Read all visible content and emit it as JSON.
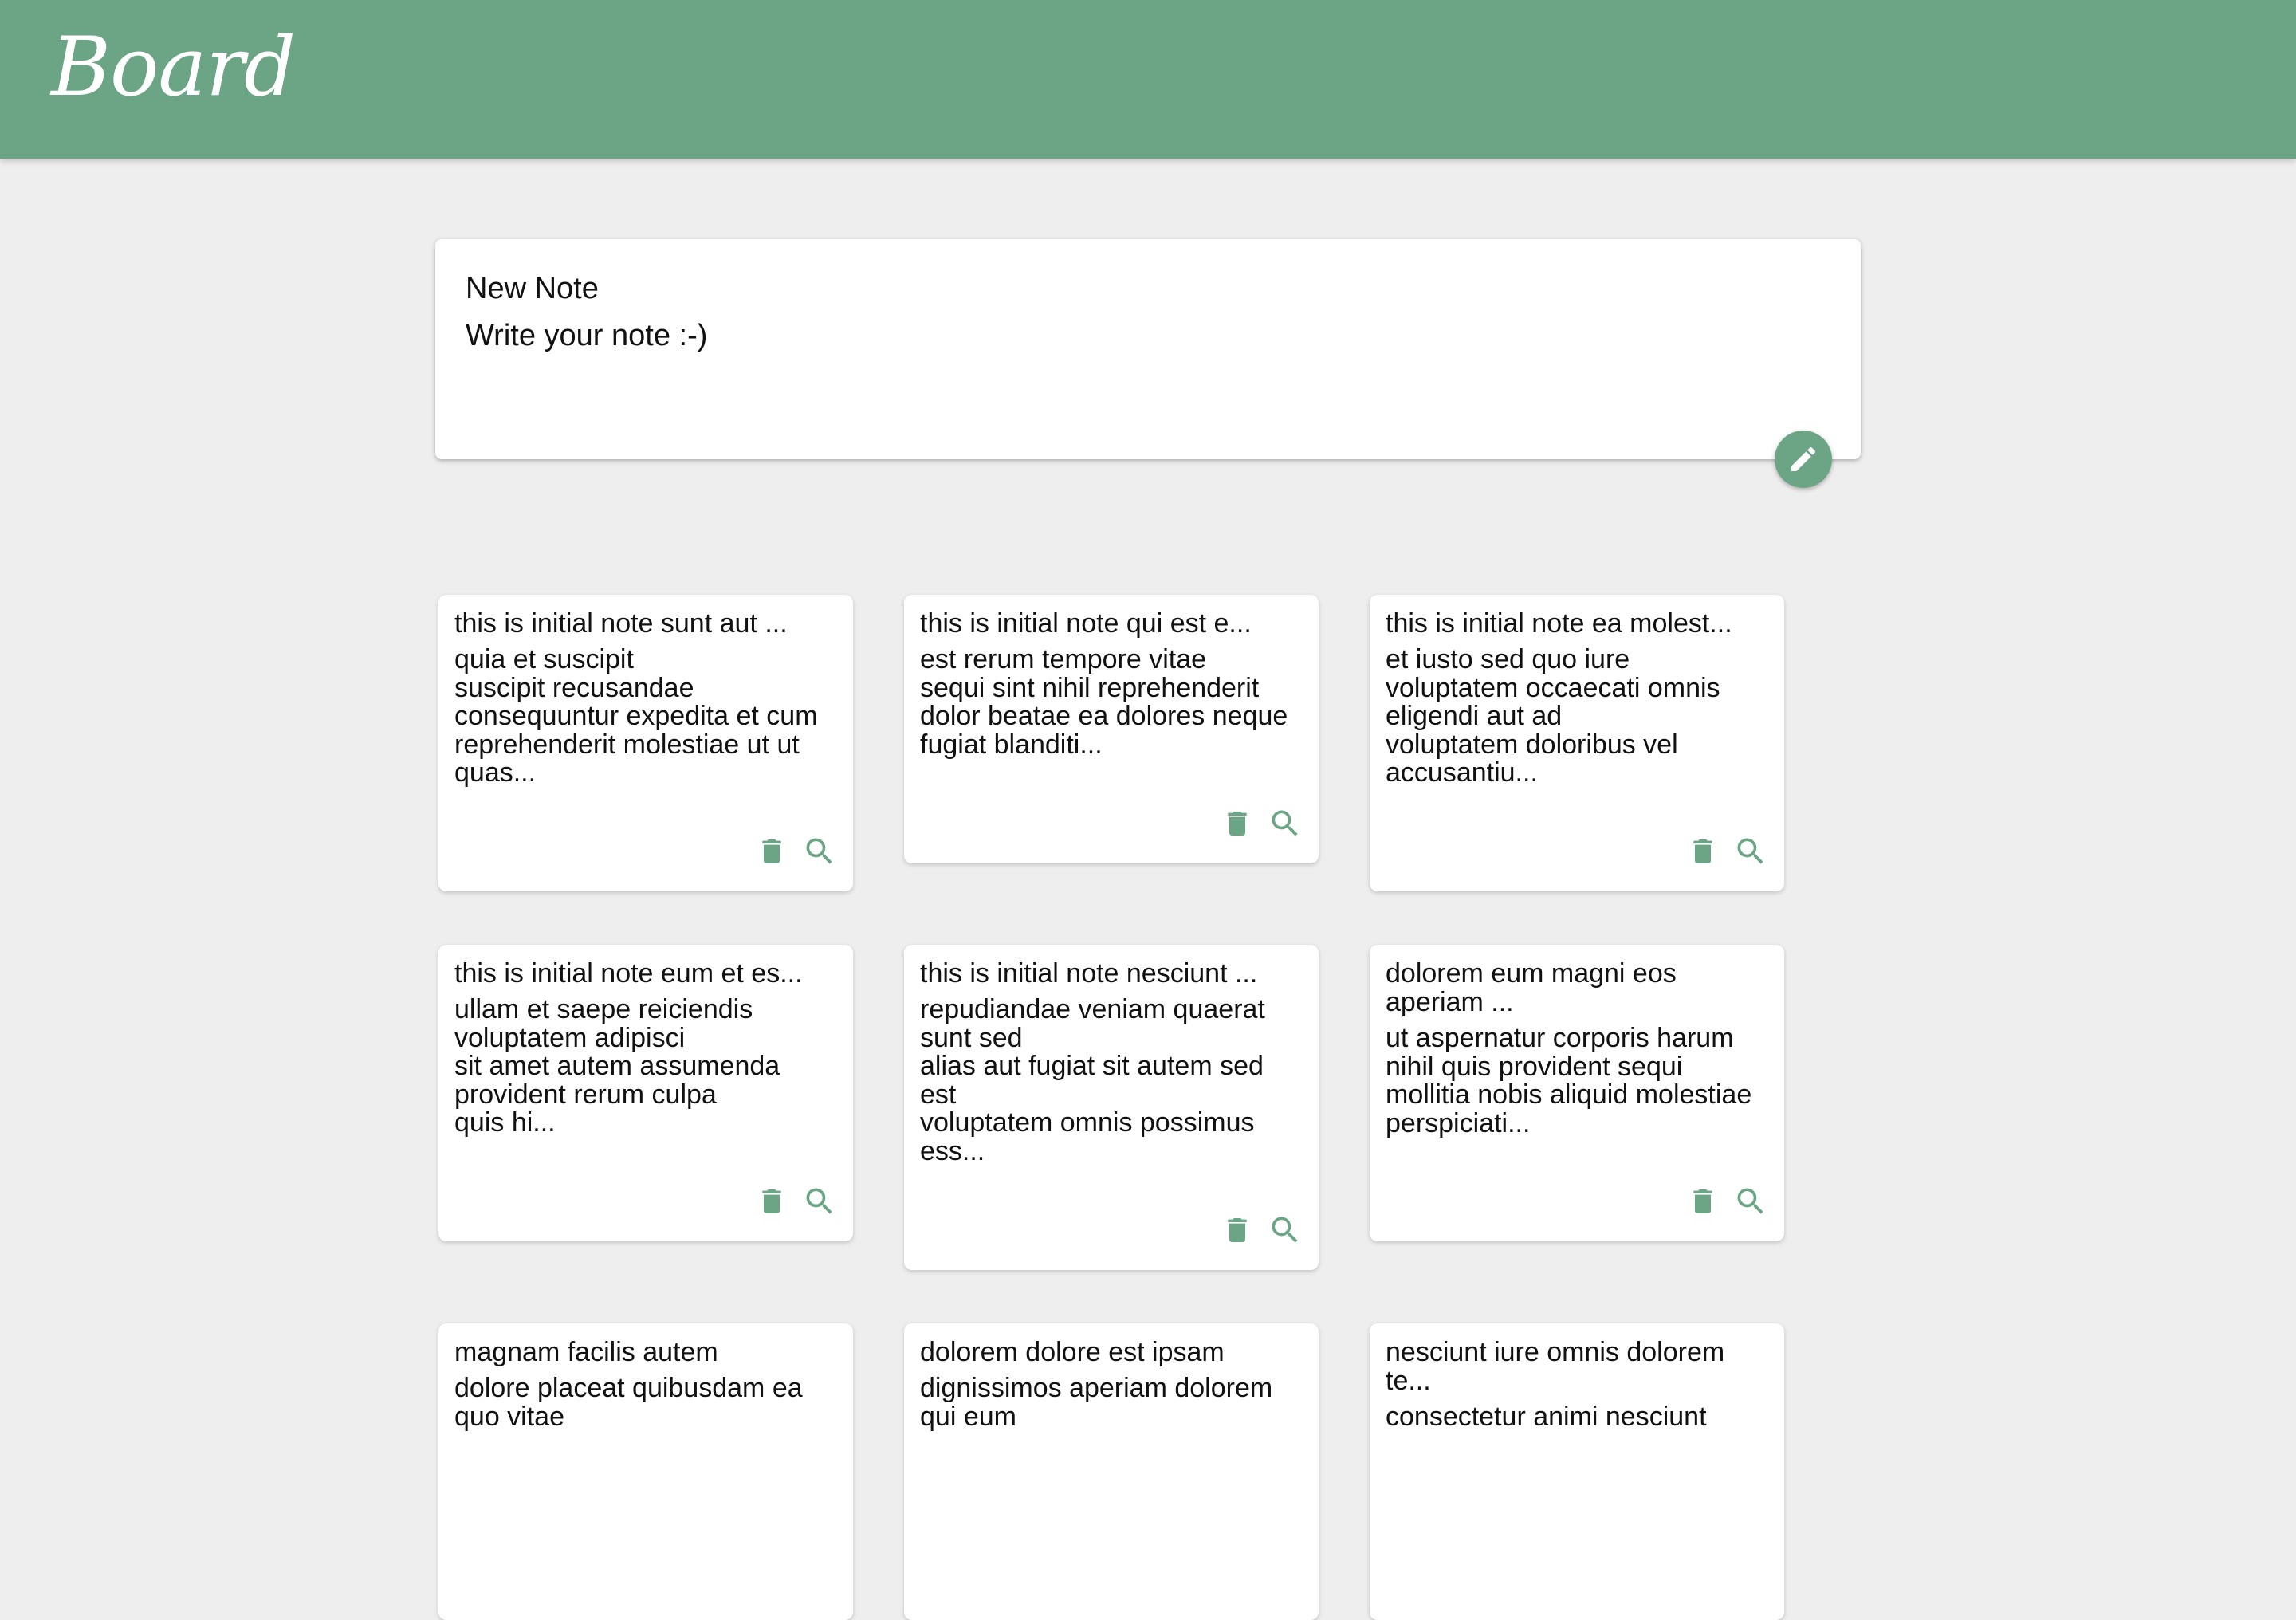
{
  "header": {
    "brand": "Board"
  },
  "composer": {
    "title_placeholder": "New Note",
    "body_placeholder": "Write your note :-)",
    "submit_icon": "pencil-icon"
  },
  "colors": {
    "accent": "#6ca585",
    "background": "#eeeeee",
    "card": "#ffffff"
  },
  "notes": [
    {
      "title": "this is initial note sunt aut ...",
      "body": "quia et suscipit\nsuscipit recusandae\nconsequuntur expedita et cum\nreprehenderit molestiae ut ut\nquas..."
    },
    {
      "title": "this is initial note qui est e...",
      "body": "est rerum tempore vitae\nsequi sint nihil reprehenderit\ndolor beatae ea dolores neque\nfugiat blanditi..."
    },
    {
      "title": "this is initial note ea molest...",
      "body": "et iusto sed quo iure\nvoluptatem occaecati omnis\neligendi aut ad\nvoluptatem doloribus vel\naccusantiu..."
    },
    {
      "title": "this is initial note eum et es...",
      "body": "ullam et saepe reiciendis\nvoluptatem adipisci\nsit amet autem assumenda\nprovident rerum culpa\nquis hi..."
    },
    {
      "title": "this is initial note nesciunt ...",
      "body": "repudiandae veniam quaerat\nsunt sed\nalias aut fugiat sit autem sed\nest\nvoluptatem omnis possimus\ness..."
    },
    {
      "title": "dolorem eum magni eos\naperiam ...",
      "body": "ut aspernatur corporis harum\nnihil quis provident sequi\nmollitia nobis aliquid molestiae\nperspiciati..."
    },
    {
      "title": "magnam facilis autem",
      "body": "dolore placeat quibusdam ea\nquo vitae"
    },
    {
      "title": "dolorem dolore est ipsam",
      "body": "dignissimos aperiam dolorem\nqui eum"
    },
    {
      "title": "nesciunt iure omnis dolorem\nte...",
      "body": "consectetur animi nesciunt"
    }
  ]
}
